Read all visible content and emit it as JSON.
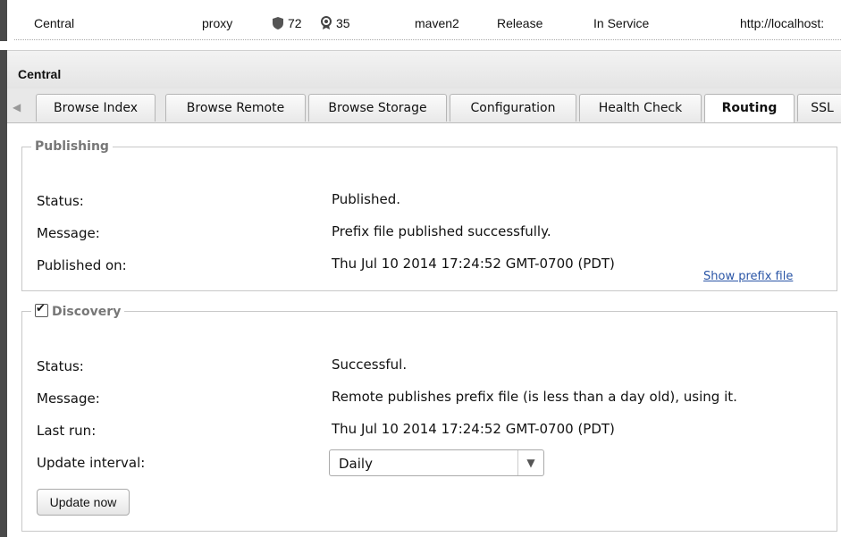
{
  "repo_row": {
    "name": "Central",
    "type": "proxy",
    "shield_count": "72",
    "award_count": "35",
    "format": "maven2",
    "policy": "Release",
    "status": "In Service",
    "url": "http://localhost:"
  },
  "panel": {
    "title": "Central"
  },
  "tabs": [
    {
      "label": "Browse Index"
    },
    {
      "label": "Browse Remote"
    },
    {
      "label": "Browse Storage"
    },
    {
      "label": "Configuration"
    },
    {
      "label": "Health Check"
    },
    {
      "label": "Routing"
    },
    {
      "label": "SSL"
    }
  ],
  "publishing": {
    "legend": "Publishing",
    "status_label": "Status:",
    "status_value": "Published.",
    "message_label": "Message:",
    "message_value": "Prefix file published successfully.",
    "published_on_label": "Published on:",
    "published_on_value": "Thu Jul 10 2014 17:24:52 GMT-0700 (PDT)",
    "show_prefix_link": "Show prefix file"
  },
  "discovery": {
    "legend": "Discovery",
    "enabled": true,
    "status_label": "Status:",
    "status_value": "Successful.",
    "message_label": "Message:",
    "message_value": "Remote publishes prefix file (is less than a day old), using it.",
    "last_run_label": "Last run:",
    "last_run_value": "Thu Jul 10 2014 17:24:52 GMT-0700 (PDT)",
    "interval_label": "Update interval:",
    "interval_value": "Daily",
    "update_button": "Update now"
  },
  "icons": {
    "shield": "shield-icon",
    "award": "award-icon",
    "scroll_left": "arrow-left-icon",
    "dropdown": "chevron-down-icon",
    "checkbox": "checkbox-checked-icon"
  }
}
